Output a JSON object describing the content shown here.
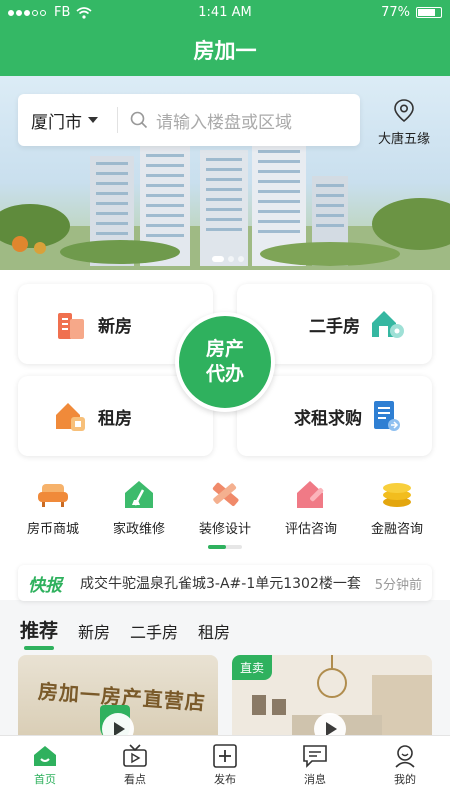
{
  "status": {
    "carrier": "FB",
    "time": "1:41 AM",
    "battery": "77%"
  },
  "header": {
    "title": "房加一"
  },
  "search": {
    "city": "厦门市",
    "placeholder": "请输入楼盘或区域",
    "location": "大唐五缘"
  },
  "categories": {
    "new_house": "新房",
    "second_hand": "二手房",
    "rent": "租房",
    "want_rent_buy": "求租求购",
    "center_line1": "房产",
    "center_line2": "代办"
  },
  "services": [
    {
      "label": "房币商城",
      "icon": "sofa-icon"
    },
    {
      "label": "家政维修",
      "icon": "broom-house-icon"
    },
    {
      "label": "装修设计",
      "icon": "ruler-pencil-icon"
    },
    {
      "label": "评估咨询",
      "icon": "house-pen-icon"
    },
    {
      "label": "金融咨询",
      "icon": "coins-icon"
    }
  ],
  "news": {
    "tag": "快报",
    "text": "成交牛驼温泉孔雀城3-A#-1单元1302楼一套",
    "time": "5分钟前"
  },
  "feed_tabs": {
    "recommend": "推荐",
    "new_house": "新房",
    "second_hand": "二手房",
    "rent": "租房"
  },
  "tiles": {
    "right_badge": "直卖",
    "left_sign": "房加一房产直营店"
  },
  "tabbar": {
    "home": "首页",
    "watch": "看点",
    "publish": "发布",
    "messages": "消息",
    "mine": "我的"
  },
  "colors": {
    "primary": "#34b865",
    "accent_orange": "#f08a3a",
    "accent_blue": "#2f7fd3"
  }
}
